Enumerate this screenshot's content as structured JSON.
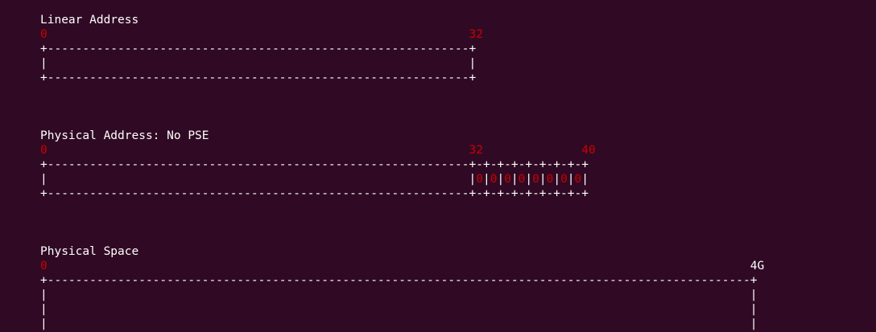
{
  "colors": {
    "background": "#300a24",
    "text": "#ffffff",
    "highlight": "#cc0000"
  },
  "sections": [
    {
      "title": "Linear Address",
      "scale": [
        {
          "text": "0",
          "color": "red"
        },
        {
          "text": "                                                            ",
          "color": "white"
        },
        {
          "text": "32",
          "color": "red"
        }
      ],
      "rows": [
        [
          {
            "text": "+------------------------------------------------------------+",
            "color": "white"
          }
        ],
        [
          {
            "text": "|                                                            |",
            "color": "white"
          }
        ],
        [
          {
            "text": "+------------------------------------------------------------+",
            "color": "white"
          }
        ]
      ]
    },
    {
      "title": "Physical Address: No PSE",
      "scale": [
        {
          "text": "0",
          "color": "red"
        },
        {
          "text": "                                                            ",
          "color": "white"
        },
        {
          "text": "32",
          "color": "red"
        },
        {
          "text": "              ",
          "color": "white"
        },
        {
          "text": "40",
          "color": "red"
        }
      ],
      "rows": [
        [
          {
            "text": "+------------------------------------------------------------+-+-+-+-+-+-+-+-+",
            "color": "white"
          }
        ],
        [
          {
            "text": "|                                                            |",
            "color": "white"
          },
          {
            "text": "0",
            "color": "red"
          },
          {
            "text": "|",
            "color": "white"
          },
          {
            "text": "0",
            "color": "red"
          },
          {
            "text": "|",
            "color": "white"
          },
          {
            "text": "0",
            "color": "red"
          },
          {
            "text": "|",
            "color": "white"
          },
          {
            "text": "0",
            "color": "red"
          },
          {
            "text": "|",
            "color": "white"
          },
          {
            "text": "0",
            "color": "red"
          },
          {
            "text": "|",
            "color": "white"
          },
          {
            "text": "0",
            "color": "red"
          },
          {
            "text": "|",
            "color": "white"
          },
          {
            "text": "0",
            "color": "red"
          },
          {
            "text": "|",
            "color": "white"
          },
          {
            "text": "0",
            "color": "red"
          },
          {
            "text": "|",
            "color": "white"
          }
        ],
        [
          {
            "text": "+------------------------------------------------------------+-+-+-+-+-+-+-+-+",
            "color": "white"
          }
        ]
      ]
    },
    {
      "title": "Physical Space",
      "scale": [
        {
          "text": "0",
          "color": "red"
        },
        {
          "text": "                                                                                                    ",
          "color": "white"
        },
        {
          "text": "4G",
          "color": "white"
        }
      ],
      "rows": [
        [
          {
            "text": "+----------------------------------------------------------------------------------------------------+",
            "color": "white"
          }
        ],
        [
          {
            "text": "|                                                                                                    |",
            "color": "white"
          }
        ],
        [
          {
            "text": "|                                                                                                    |",
            "color": "white"
          }
        ],
        [
          {
            "text": "|                                                                                                    |",
            "color": "white"
          }
        ],
        [
          {
            "text": "+----------------------------------------------------------------------------------------------------+",
            "color": "white"
          }
        ]
      ]
    }
  ]
}
